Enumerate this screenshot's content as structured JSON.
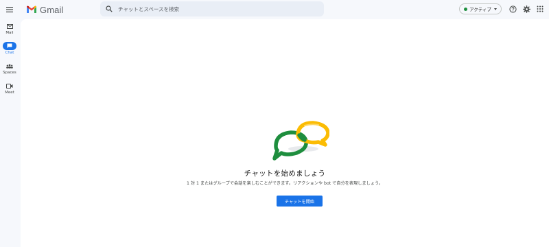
{
  "app": {
    "name": "Gmail"
  },
  "search": {
    "placeholder": "チャットとスペースを検索"
  },
  "status": {
    "label": "アクティブ",
    "color": "#1e8e3e"
  },
  "header_icons": [
    "help-icon",
    "settings-icon",
    "apps-grid-icon"
  ],
  "rail": {
    "items": [
      {
        "id": "mail",
        "label": "Mail",
        "icon": "mail-icon",
        "active": false
      },
      {
        "id": "chat",
        "label": "Chat",
        "icon": "chat-icon",
        "active": true
      },
      {
        "id": "spaces",
        "label": "Spaces",
        "icon": "spaces-icon",
        "active": false
      },
      {
        "id": "meet",
        "label": "Meet",
        "icon": "video-icon",
        "active": false
      }
    ]
  },
  "empty_state": {
    "title": "チャットを始めましょう",
    "subtitle": "1 対 1 またはグループで会話を楽しむことができます。リアクションや bot で自分を表現しましょう。",
    "button_label": "チャットを開始"
  },
  "colors": {
    "accent": "#1a73e8",
    "background": "#f6f8fc",
    "panel": "#ffffff"
  }
}
